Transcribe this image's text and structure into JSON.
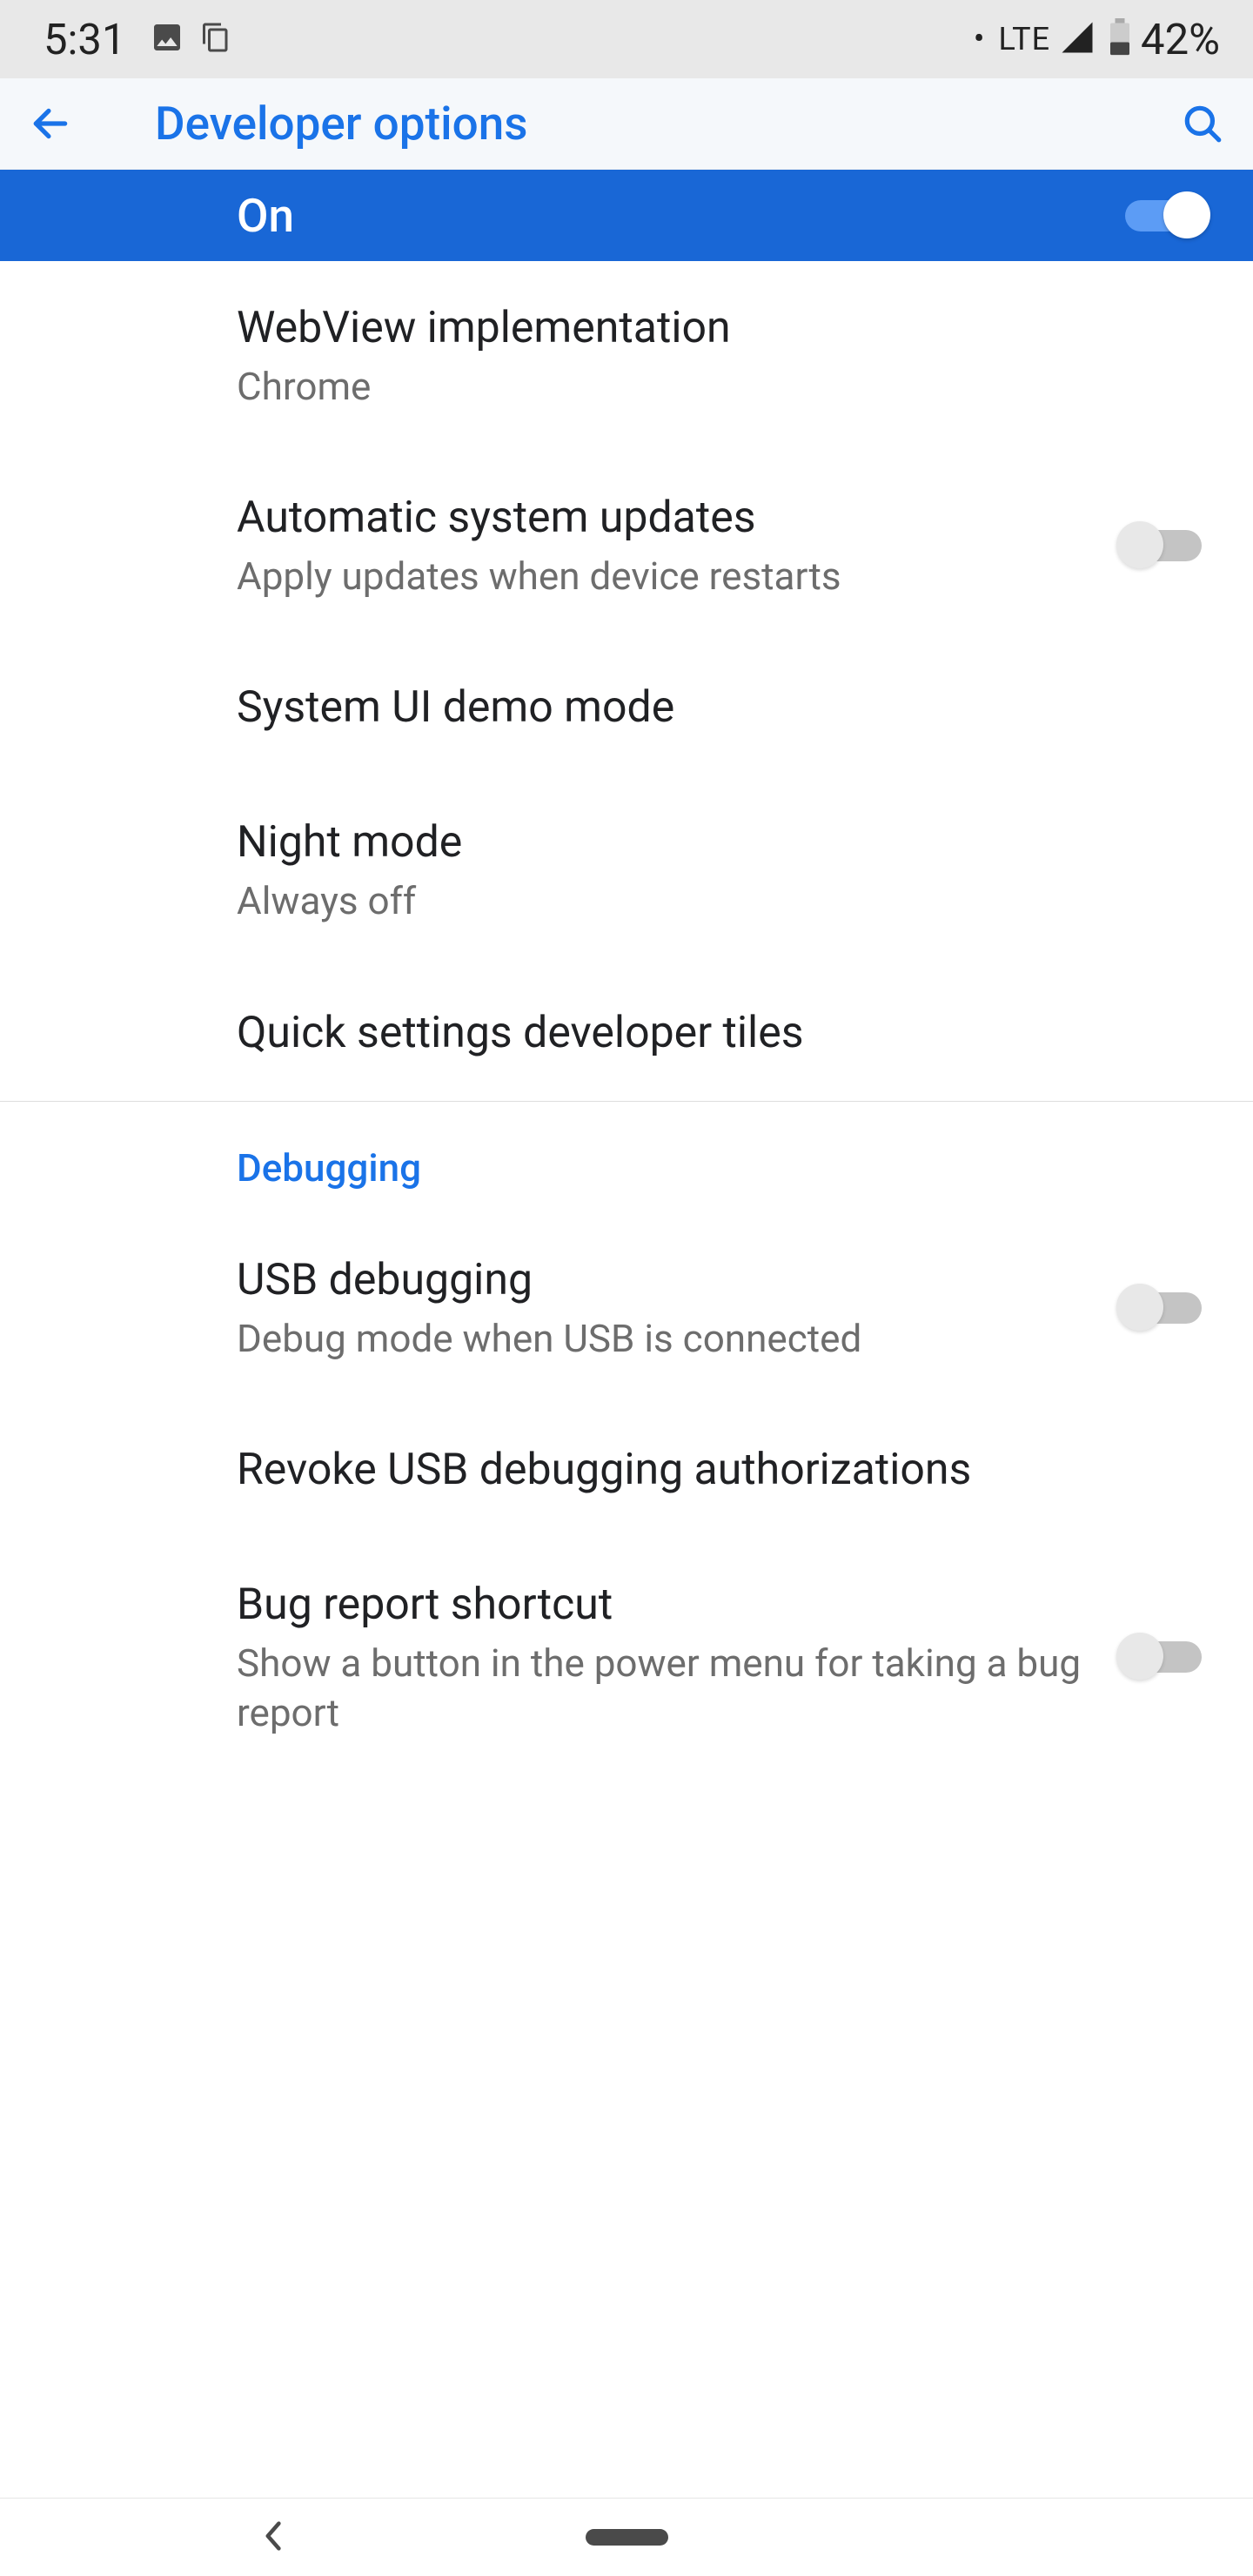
{
  "status_bar": {
    "time": "5:31",
    "network_type": "LTE",
    "battery_percent": "42%"
  },
  "header": {
    "title": "Developer options"
  },
  "master": {
    "label": "On",
    "state": true
  },
  "items": [
    {
      "title": "WebView implementation",
      "subtitle": "Chrome",
      "has_switch": false
    },
    {
      "title": "Automatic system updates",
      "subtitle": "Apply updates when device restarts",
      "has_switch": true,
      "switch_on": false
    },
    {
      "title": "System UI demo mode",
      "subtitle": null,
      "has_switch": false
    },
    {
      "title": "Night mode",
      "subtitle": "Always off",
      "has_switch": false
    },
    {
      "title": "Quick settings developer tiles",
      "subtitle": null,
      "has_switch": false
    }
  ],
  "section_debug_title": "Debugging",
  "debug_items": [
    {
      "title": "USB debugging",
      "subtitle": "Debug mode when USB is connected",
      "has_switch": true,
      "switch_on": false
    },
    {
      "title": "Revoke USB debugging authorizations",
      "subtitle": null,
      "has_switch": false
    },
    {
      "title": "Bug report shortcut",
      "subtitle": "Show a button in the power menu for taking a bug report",
      "has_switch": true,
      "switch_on": false
    }
  ]
}
